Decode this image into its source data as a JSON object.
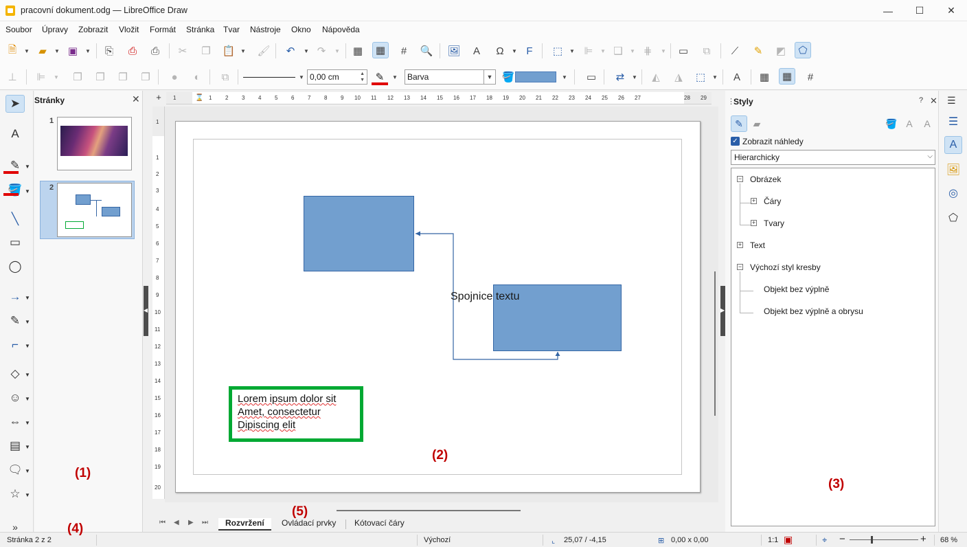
{
  "window": {
    "title": "pracovní dokument.odg — LibreOffice Draw",
    "min": "—",
    "max": "☐",
    "close": "✕"
  },
  "menu": [
    "Soubor",
    "Úpravy",
    "Zobrazit",
    "Vložit",
    "Formát",
    "Stránka",
    "Tvar",
    "Nástroje",
    "Okno",
    "Nápověda"
  ],
  "toolbar2": {
    "line_width": "0,00 cm",
    "area_fill": "Barva"
  },
  "pages_panel": {
    "title": "Stránky",
    "close": "✕",
    "pages": [
      "1",
      "2"
    ],
    "annotation": "(1)"
  },
  "canvas": {
    "connector_label": "Spojnice textu",
    "textbox_lines": [
      "Lorem ipsum dolor sit",
      "Amet, consectetur",
      "Dipiscing elit"
    ],
    "annotation": "(2)"
  },
  "tabs": {
    "items": [
      "Rozvržení",
      "Ovládací prvky",
      "Kótovací čáry"
    ],
    "active": 0,
    "annotation": "(5)"
  },
  "styles_panel": {
    "title": "Styly",
    "help": "?",
    "close": "✕",
    "menu": "☰",
    "show_previews": "Zobrazit náhledy",
    "filter": "Hierarchicky",
    "tree": [
      "Obrázek",
      "Čáry",
      "Tvary",
      "Text",
      "Výchozí styl kresby",
      "Objekt bez výplně",
      "Objekt bez výplně a obrysu"
    ],
    "annotation": "(3)"
  },
  "statusbar": {
    "page": "Stránka 2 z 2",
    "style": "Výchozí",
    "position": "25,07 / -4,15",
    "size": "0,00 x 0,00",
    "scale": "1:1",
    "zoom": "68 %",
    "annotation": "(4)"
  },
  "colors": {
    "shape_fill": "#729fcf",
    "shape_border": "#3465a4",
    "textbox_border": "#00a933",
    "annotation": "#c00000",
    "accent": "#2a5ea8"
  }
}
